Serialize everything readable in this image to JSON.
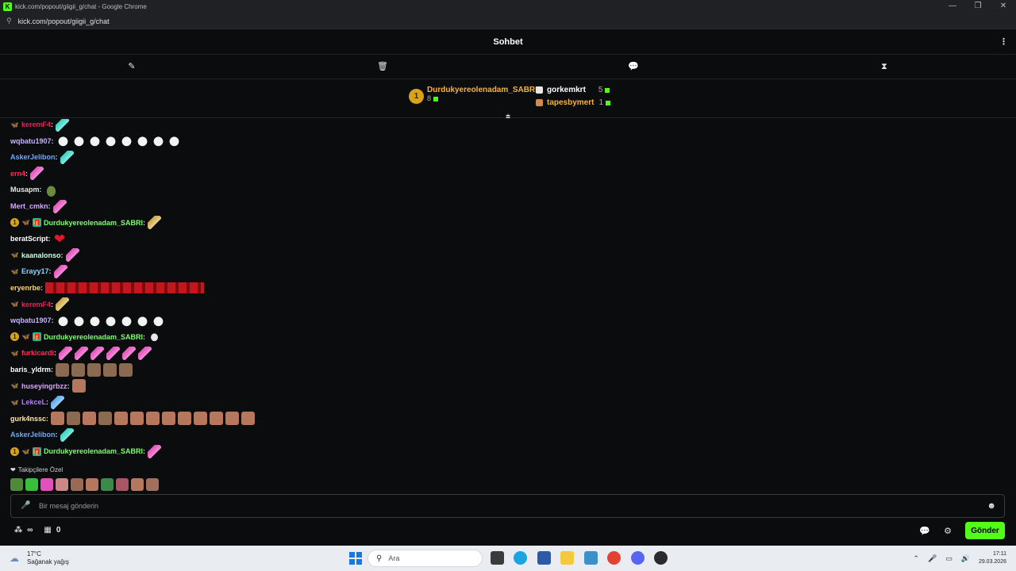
{
  "window": {
    "title": "kick.com/popout/giigii_g/chat - Google Chrome",
    "url": "kick.com/popout/giigii_g/chat",
    "logo": "K",
    "minimize": "—",
    "restore": "❐",
    "close": "✕"
  },
  "chat": {
    "title": "Sohbet",
    "more_icon": "⋮"
  },
  "mod_tools": {
    "pin_icon": "✎",
    "trash_icon": "🗑",
    "chat_icon": "💬",
    "timer_icon": "⧗"
  },
  "leaderboard": {
    "first": {
      "rank": "1",
      "name": "Durdukyereolenadam_SABRI",
      "count": "8"
    },
    "second": {
      "name": "gorkemkrt",
      "count": "5"
    },
    "third": {
      "name": "tapesbymert",
      "count": "1"
    },
    "collapse_icon": "⩧"
  },
  "messages": [
    {
      "user": "keremF4",
      "color": "#e0245e",
      "badges": [
        "butterfly"
      ],
      "emotes": [
        "icecyan"
      ]
    },
    {
      "user": "wqbatu1907",
      "color": "#c9b3ff",
      "badges": [],
      "emotes": [
        "duck",
        "duck",
        "duck",
        "duck",
        "duck",
        "duck",
        "duck",
        "duck"
      ]
    },
    {
      "user": "AskerJelibon",
      "color": "#6aa9ff",
      "badges": [],
      "emotes": [
        "icecyan"
      ]
    },
    {
      "user": "ern4",
      "color": "#ff2d5b",
      "badges": [],
      "emotes": [
        "ice"
      ]
    },
    {
      "user": "Musapm",
      "color": "#e8e8e8",
      "badges": [],
      "emotes": [
        "frog"
      ]
    },
    {
      "user": "Mert_cmkn",
      "color": "#d7a8ff",
      "badges": [],
      "emotes": [
        "ice"
      ]
    },
    {
      "user": "Durdukyereolenadam_SABRI",
      "color": "#7cff6b",
      "badges": [
        "medal",
        "butterfly",
        "gift"
      ],
      "emotes": [
        "hands"
      ]
    },
    {
      "user": "beratScript",
      "color": "#ffffff",
      "badges": [],
      "emotes": [
        "heart"
      ]
    },
    {
      "user": "kaanalonso",
      "color": "#c9ffe0",
      "badges": [
        "butterfly"
      ],
      "emotes": [
        "ice"
      ]
    },
    {
      "user": "Erayy17",
      "color": "#8ad6ff",
      "badges": [
        "butterfly-orange"
      ],
      "emotes": [
        "ice"
      ]
    },
    {
      "user": "eryenrbe",
      "color": "#ffd36b",
      "badges": [],
      "emotes": [
        "xdx"
      ]
    },
    {
      "user": "keremF4",
      "color": "#e0245e",
      "badges": [
        "butterfly"
      ],
      "emotes": [
        "hands"
      ]
    },
    {
      "user": "wqbatu1907",
      "color": "#c9b3ff",
      "badges": [],
      "emotes": [
        "duck",
        "duck",
        "duck",
        "duck",
        "duck",
        "duck",
        "duck"
      ]
    },
    {
      "user": "Durdukyereolenadam_SABRI",
      "color": "#7cff6b",
      "badges": [
        "medal",
        "butterfly",
        "gift"
      ],
      "emotes": [
        "leaf"
      ]
    },
    {
      "user": "furkicardi",
      "color": "#ff2d5b",
      "badges": [
        "butterfly"
      ],
      "emotes": [
        "ice",
        "ice",
        "ice",
        "ice",
        "ice",
        "ice"
      ]
    },
    {
      "user": "baris_yldrm",
      "color": "#ffffff",
      "badges": [],
      "emotes": [
        "cat",
        "cat",
        "cat",
        "cat",
        "cat"
      ]
    },
    {
      "user": "huseyingrbzz",
      "color": "#d7a8ff",
      "badges": [
        "butterfly"
      ],
      "emotes": [
        "face"
      ]
    },
    {
      "user": "LekceL",
      "color": "#b57cff",
      "badges": [
        "butterfly"
      ],
      "emotes": [
        "iceblue"
      ]
    },
    {
      "user": "gurk4nssc",
      "color": "#ffe7a3",
      "badges": [],
      "emotes": [
        "face",
        "cat",
        "face",
        "cat",
        "face",
        "face",
        "face",
        "face",
        "face",
        "face",
        "face",
        "face",
        "face"
      ]
    },
    {
      "user": "AskerJelibon",
      "color": "#6aa9ff",
      "badges": [],
      "emotes": [
        "icecyan"
      ]
    },
    {
      "user": "Durdukyereolenadam_SABRI",
      "color": "#7cff6b",
      "badges": [
        "medal",
        "butterfly",
        "gift"
      ],
      "emotes": [
        "ice"
      ]
    }
  ],
  "followers_only": {
    "label": "Takipçilere Özel",
    "emotes": [
      "#4f8a3b",
      "#3bbf3b",
      "#e052b9",
      "#c88",
      "#9b6a55",
      "#b5775e",
      "#3c8a4a",
      "#a56",
      "#b5775e",
      "#a0705a"
    ]
  },
  "input": {
    "placeholder": "Bir mesaj gönderin",
    "mic_icon": "🎤",
    "emoji_icon": "☻"
  },
  "bottom": {
    "points_icon": "∞",
    "points_prefix": "⁂",
    "store_icon": "▦",
    "store_count": "0",
    "chat_icon": "💬",
    "settings_icon": "⚙",
    "send_label": "Gönder"
  },
  "taskbar": {
    "temperature": "17°C",
    "weather_text": "Sağanak yağış",
    "search_placeholder": "Ara",
    "time": "17:11",
    "date": "29.03.2026",
    "tray_up": "⌃",
    "tray_mic": "🎤",
    "tray_net": "▭",
    "tray_vol": "🔊"
  },
  "colors": {
    "brand_green": "#53fc18",
    "background": "#0b0c0e",
    "gold": "#f7b33a"
  }
}
